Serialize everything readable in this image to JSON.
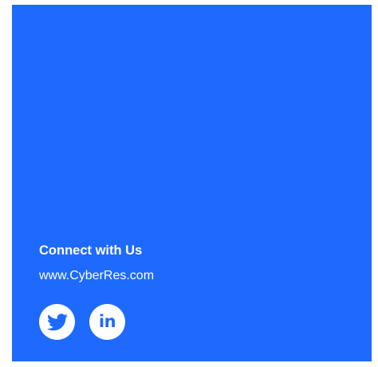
{
  "connect": {
    "heading": "Connect with Us",
    "website": "www.CyberRes.com"
  },
  "social": {
    "twitter_icon": "twitter-bird-icon",
    "linkedin_icon": "linkedin-icon",
    "linkedin_glyph": "in"
  },
  "colors": {
    "panel_background": "#1e6aff",
    "text": "#ffffff",
    "icon_background": "#ffffff",
    "icon_glyph": "#1e6aff"
  }
}
